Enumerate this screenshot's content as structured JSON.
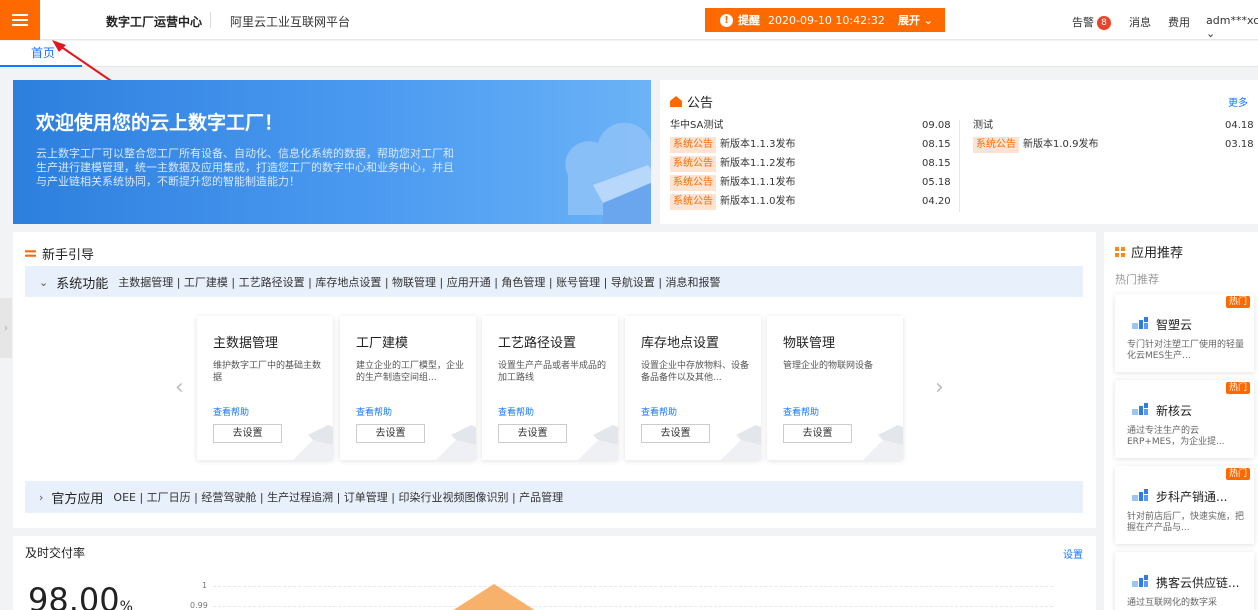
{
  "header": {
    "brand": "数字工厂运营中心",
    "platform": "阿里云工业互联网平台",
    "alert_label": "提醒",
    "alert_time": "2020-09-10 10:42:32",
    "alert_expand": "展开",
    "alarm": "告警",
    "alarm_count": "8",
    "messages": "消息",
    "fees": "费用",
    "user": "adm***xc"
  },
  "tabs": [
    {
      "label": "首页"
    }
  ],
  "hero": {
    "title": "欢迎使用您的云上数字工厂！",
    "desc": "云上数字工厂可以整合您工厂所有设备、自动化、信息化系统的数据，帮助您对工厂和生产进行建模管理，统一主数据及应用集成，打造您工厂的数字中心和业务中心，并且与产业链相关系统协同，不断提升您的智能制造能力！"
  },
  "notice": {
    "title": "公告",
    "more": "更多",
    "tag": "系统公告",
    "left": [
      {
        "tag": "",
        "text": "华中SA测试",
        "date": "09.08"
      },
      {
        "tag": "系统公告",
        "text": "新版本1.1.3发布",
        "date": "08.15"
      },
      {
        "tag": "系统公告",
        "text": "新版本1.1.2发布",
        "date": "08.15"
      },
      {
        "tag": "系统公告",
        "text": "新版本1.1.1发布",
        "date": "05.18"
      },
      {
        "tag": "系统公告",
        "text": "新版本1.1.0发布",
        "date": "04.20"
      }
    ],
    "right": [
      {
        "tag": "",
        "text": "测试",
        "date": "04.18"
      },
      {
        "tag": "系统公告",
        "text": "新版本1.0.9发布",
        "date": "03.18"
      }
    ]
  },
  "guide": {
    "title": "新手引导",
    "sys_title": "系统功能",
    "sys_items": "主数据管理 | 工厂建模 | 工艺路径设置 | 库存地点设置 | 物联管理 | 应用开通 | 角色管理 | 账号管理 | 导航设置 | 消息和报警",
    "off_title": "官方应用",
    "off_items": "OEE | 工厂日历 | 经营驾驶舱 | 生产过程追溯 | 订单管理 | 印染行业视频图像识别 | 产品管理",
    "cards": [
      {
        "title": "主数据管理",
        "desc": "维护数字工厂中的基础主数据",
        "help": "查看帮助",
        "btn": "去设置"
      },
      {
        "title": "工厂建模",
        "desc": "建立企业的工厂模型，企业的生产制造空间组...",
        "help": "查看帮助",
        "btn": "去设置"
      },
      {
        "title": "工艺路径设置",
        "desc": "设置生产产品或者半成品的加工路线",
        "help": "查看帮助",
        "btn": "去设置"
      },
      {
        "title": "库存地点设置",
        "desc": "设置企业中存放物料、设备备品备件以及其他...",
        "help": "查看帮助",
        "btn": "去设置"
      },
      {
        "title": "物联管理",
        "desc": "管理企业的物联网设备",
        "help": "查看帮助",
        "btn": "去设置"
      }
    ]
  },
  "kpi": {
    "title": "及时交付率",
    "settings": "设置",
    "value": "98.00",
    "unit": "%",
    "y_top": "1",
    "y_next": "0.99"
  },
  "apps": {
    "title": "应用推荐",
    "subtitle": "热门推荐",
    "hot": "热门",
    "items": [
      {
        "name": "智塑云",
        "desc": "专门针对注塑工厂使用的轻量化云MES生产...",
        "hot": true
      },
      {
        "name": "新核云",
        "desc": "通过专注生产的云ERP+MES，为企业提...",
        "hot": true
      },
      {
        "name": "步科产销通...",
        "desc": "针对前店后厂，快速实施，把握在产产品与...",
        "hot": true
      },
      {
        "name": "携客云供应链...",
        "desc": "通过互联网化的数字采",
        "hot": false
      }
    ]
  },
  "colors": {
    "accent": "#ff6a00",
    "link": "#1677ff"
  }
}
